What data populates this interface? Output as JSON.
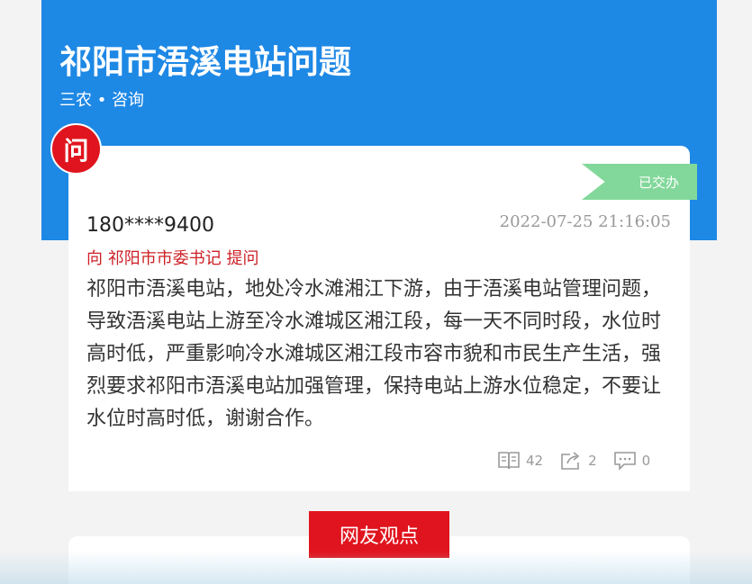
{
  "header": {
    "title": "祁阳市浯溪电站问题",
    "category": "三农 • 咨询"
  },
  "question": {
    "badge": "问",
    "status": "已交办",
    "author": "180****9400",
    "datetime": "2022-07-25 21:16:05",
    "addressee": "向  祁阳市市委书记  提问",
    "content": "祁阳市浯溪电站，地处冷水滩湘江下游，由于浯溪电站管理问题，导致浯溪电站上游至冷水滩城区湘江段，每一天不同时段，水位时高时低，严重影响冷水滩城区湘江段市容市貌和市民生产生活，强烈要求祁阳市浯溪电站加强管理，保持电站上游水位稳定，不要让水位时高时低，谢谢合作。",
    "stats": {
      "views": "42",
      "shares": "2",
      "comments": "0"
    }
  },
  "opinion": {
    "label": "网友观点"
  },
  "colors": {
    "header_bg": "#1e88e5",
    "accent_red": "#e0141e",
    "status_green": "#82d89a"
  }
}
